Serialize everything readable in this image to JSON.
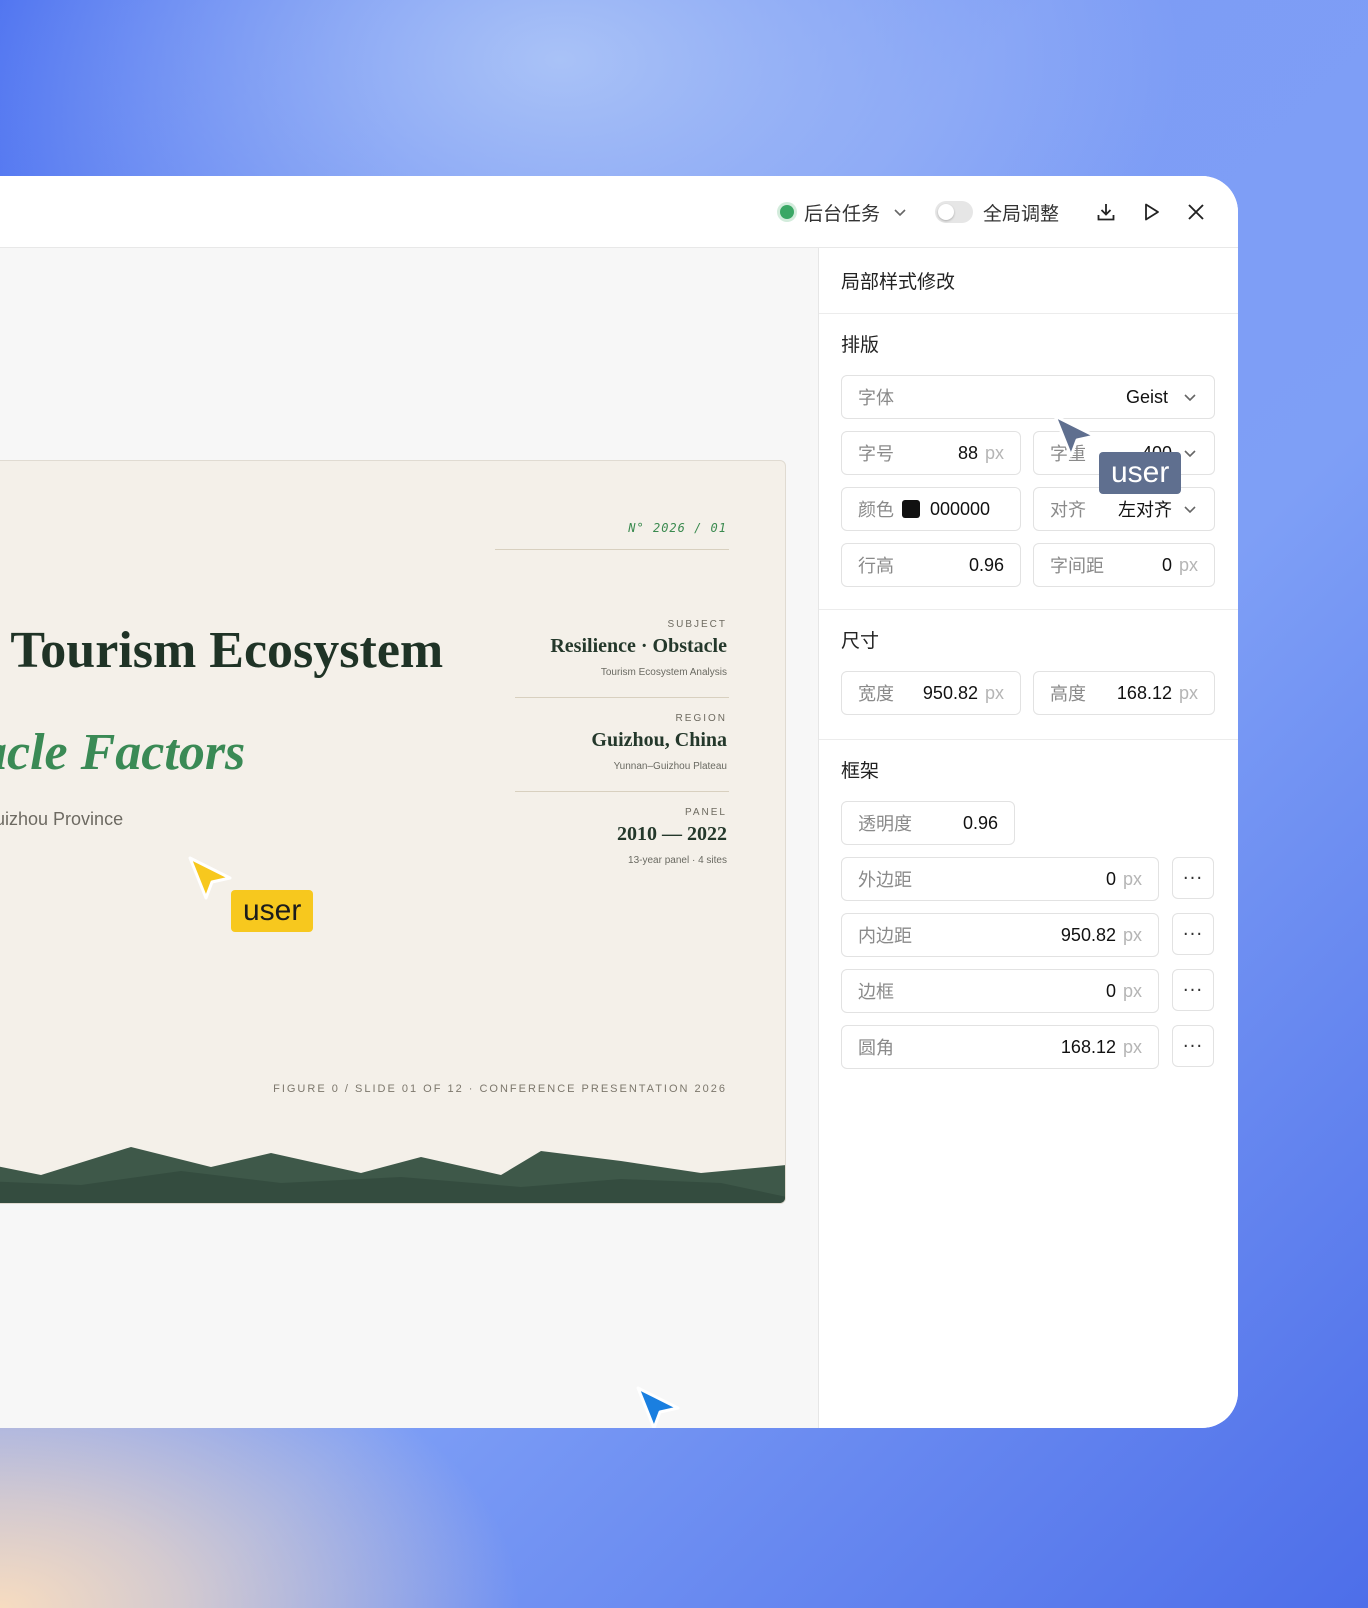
{
  "topbar": {
    "background_tasks": "后台任务",
    "global_adjust": "全局调整"
  },
  "slide": {
    "number": "N° 2026 / 01",
    "subject_caption": "SUBJECT",
    "subject_title": "Resilience · Obstacle",
    "subject_sub": "Tourism Ecosystem Analysis",
    "region_caption": "REGION",
    "region_title": "Guizhou, China",
    "region_sub": "Yunnan–Guizhou Plateau",
    "panel_caption": "PANEL",
    "panel_title": "2010 — 2022",
    "panel_sub": "13-year panel · 4 sites",
    "title_line1": "f Tourism Ecosystem",
    "title_line2": "acle Factors",
    "subtitle": "Guizhou Province",
    "footer": "FIGURE 0 / SLIDE 01 OF 12  ·  CONFERENCE PRESENTATION 2026"
  },
  "cursors": {
    "yellow_label": "user",
    "gray_label": "user",
    "blue_label": "user",
    "yellow_color": "#f7c81e",
    "gray_color": "#5f6f8f",
    "blue_color": "#1a7fe0"
  },
  "panel": {
    "title": "局部样式修改",
    "typography": {
      "title": "排版",
      "font_label": "字体",
      "font_value": "Geist",
      "size_label": "字号",
      "size_value": "88",
      "size_unit": "px",
      "weight_label": "字重",
      "weight_value": "400",
      "color_label": "颜色",
      "color_value": "000000",
      "align_label": "对齐",
      "align_value": "左对齐",
      "lineheight_label": "行高",
      "lineheight_value": "0.96",
      "letterspacing_label": "字间距",
      "letterspacing_value": "0",
      "letterspacing_unit": "px"
    },
    "size": {
      "title": "尺寸",
      "width_label": "宽度",
      "width_value": "950.82",
      "width_unit": "px",
      "height_label": "高度",
      "height_value": "168.12",
      "height_unit": "px"
    },
    "frame": {
      "title": "框架",
      "opacity_label": "透明度",
      "opacity_value": "0.96",
      "margin_label": "外边距",
      "margin_value": "0",
      "margin_unit": "px",
      "padding_label": "内边距",
      "padding_value": "950.82",
      "padding_unit": "px",
      "border_label": "边框",
      "border_value": "0",
      "border_unit": "px",
      "radius_label": "圆角",
      "radius_value": "168.12",
      "radius_unit": "px",
      "more": "···"
    }
  }
}
